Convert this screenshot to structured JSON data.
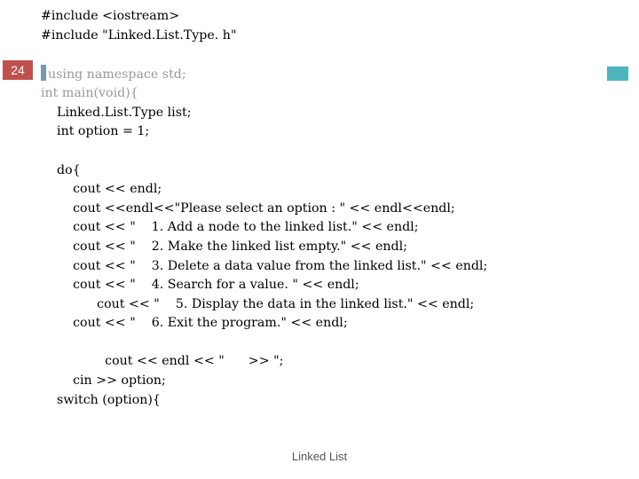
{
  "page_number": "24",
  "footer": "Linked List",
  "code": {
    "lines": [
      "#include <iostream>",
      "#include \"Linked.List.Type. h\"",
      "",
      "using namespace std;",
      "int main(void){",
      "    Linked.List.Type list;",
      "    int option = 1;",
      "",
      "    do{",
      "        cout << endl;",
      "        cout <<endl<<\"Please select an option : \" << endl<<endl;",
      "        cout << \"    1. Add a node to the linked list.\" << endl;",
      "        cout << \"    2. Make the linked list empty.\" << endl;",
      "        cout << \"    3. Delete a data value from the linked list.\" << endl;",
      "        cout << \"    4. Search for a value. \" << endl;",
      "              cout << \"    5. Display the data in the linked list.\" << endl;",
      "        cout << \"    6. Exit the program.\" << endl;",
      "",
      "                cout << endl << \"      >> \";",
      "        cin >> option;",
      "    switch (option){"
    ]
  }
}
